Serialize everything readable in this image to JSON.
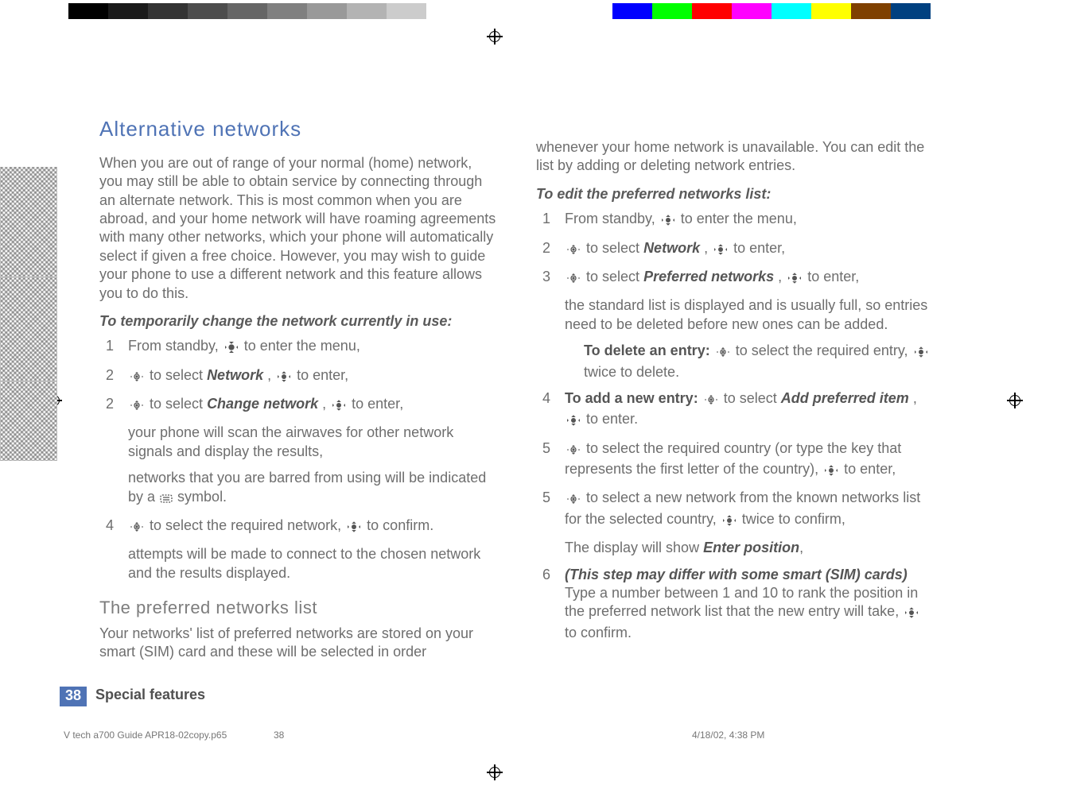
{
  "header": {
    "title": "Alternative networks"
  },
  "intro": "When you are out of range of your normal (home) network, you may still be able to obtain service by connecting through an alternate network. This is most common when you are abroad, and your home network will have roaming agreements with many other networks, which your phone will automatically select if given a free choice. However, you may wish to guide your phone to use a different network and this feature allows you to do this.",
  "section1": {
    "lead": "To temporarily change the network currently in use:",
    "s1_num": "1",
    "s1_a": "From standby, ",
    "s1_b": " to enter the menu,",
    "s2_num": "2",
    "s2_a": " to select ",
    "s2_net": "Network",
    "s2_b": ", ",
    "s2_c": " to enter,",
    "s3_num": "2",
    "s3_a": " to select ",
    "s3_chg": "Change network",
    "s3_b": ", ",
    "s3_c": " to enter,",
    "note1": "your phone will scan the airwaves for other network signals and display the results,",
    "note2a": "networks that you are barred from using will be indicated by a ",
    "note2b": " symbol.",
    "s4_num": "4",
    "s4_a": " to select the required network, ",
    "s4_b": " to confirm.",
    "note3": "attempts will be made to connect to the chosen network and the results displayed."
  },
  "section2": {
    "heading": "The preferred networks list",
    "body_a": "Your networks' list of preferred networks are stored on your smart (SIM) card and these will be selected in order ",
    "body_b": "whenever your home network is unavailable. You can edit the list by adding or deleting network entries."
  },
  "edit": {
    "lead": "To edit the preferred networks list:",
    "e1_num": "1",
    "e1_a": "From standby, ",
    "e1_b": " to enter the menu,",
    "e2_num": "2",
    "e2_a": " to select ",
    "e2_net": "Network",
    "e2_b": ", ",
    "e2_c": " to enter,",
    "e3_num": "3",
    "e3_a": " to select ",
    "e3_pn": "Preferred networks",
    "e3_b": ", ",
    "e3_c": " to enter,",
    "e3_note": "the standard list is displayed and is usually full, so entries need to be deleted before new ones can be added.",
    "del_lead": "To delete an entry:",
    "del_a": " to select the required entry, ",
    "del_b": " twice to delete.",
    "e4_num": "4",
    "e4_lead": "To add a new entry:",
    "e4_a": " to select ",
    "e4_add": "Add preferred item",
    "e4_b": ", ",
    "e4_c": " to enter.",
    "e5_num": "5",
    "e5_a": " to select the required country (or type the key that represents the first letter of the country), ",
    "e5_b": " to enter,",
    "e5b_num": "5",
    "e5b_a": " to select a new network from the known networks list for the selected country, ",
    "e5b_b": " twice to confirm,",
    "e5_note_a": "The display will show ",
    "e5_note_b": "Enter position",
    "e5_note_c": ",",
    "e6_num": "6",
    "e6_lead": "(This step may differ with some smart (SIM) cards)",
    "e6_a": " Type a number between 1 and 10 to rank the position in the preferred network list that the new entry will take, ",
    "e6_b": " to confirm."
  },
  "footer": {
    "page": "38",
    "title": "Special features",
    "file": "V tech a700 Guide APR18-02copy.p65",
    "filepage": "38",
    "timestamp": "4/18/02, 4:38 PM"
  }
}
